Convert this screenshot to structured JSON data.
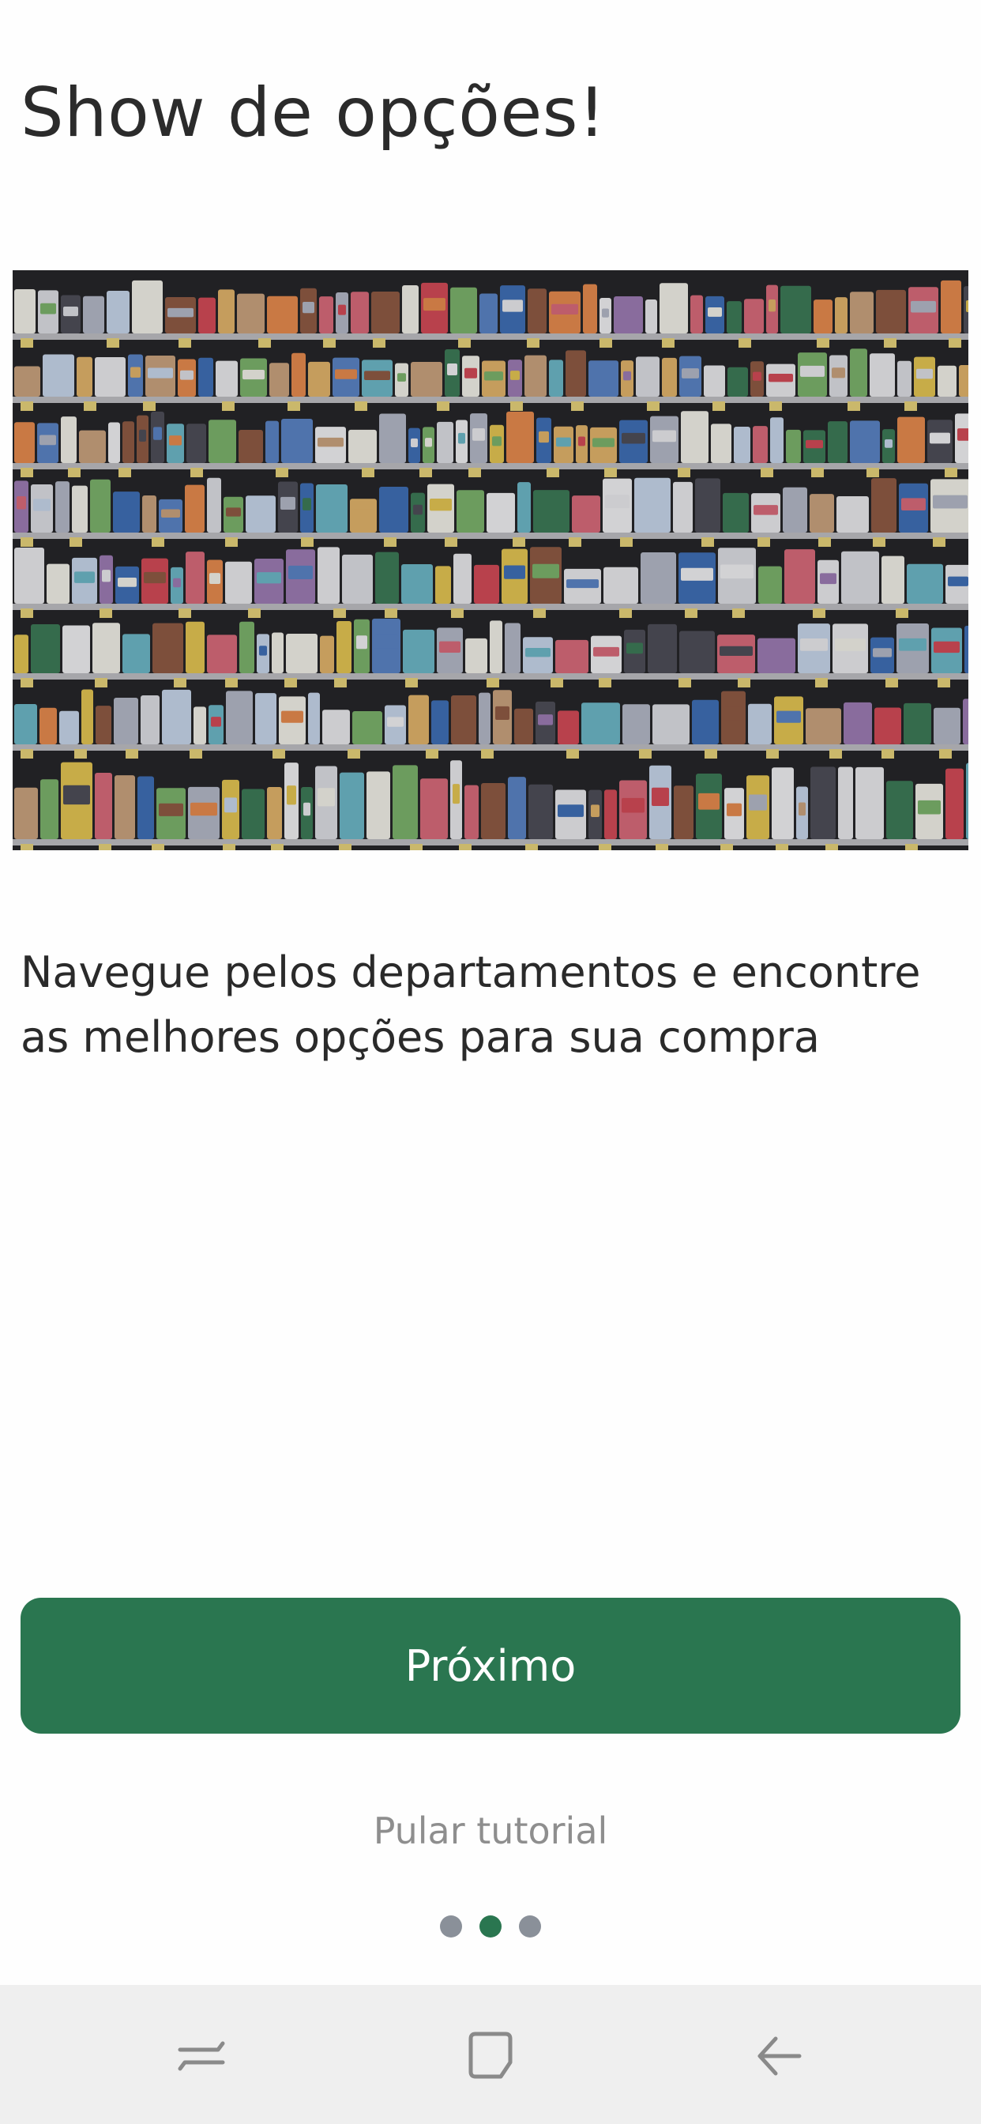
{
  "screen": {
    "title": "Show de opções!",
    "description": "Navegue pelos departamentos e encontre as melhores opções para sua compra",
    "hero_image_icon": "supermarket-shelves-image"
  },
  "actions": {
    "next_label": "Próximo",
    "skip_label": "Pular tutorial"
  },
  "pagination": {
    "total": 3,
    "current": 2
  },
  "system_nav": {
    "recents_icon": "recents-icon",
    "home_icon": "home-icon",
    "back_icon": "back-arrow-icon"
  },
  "colors": {
    "primary": "#2a7650",
    "inactive_dot": "#8a9099",
    "title_text": "#2b2b2b",
    "muted_text": "#8e8e8e",
    "navbar_bg": "#efefef"
  }
}
